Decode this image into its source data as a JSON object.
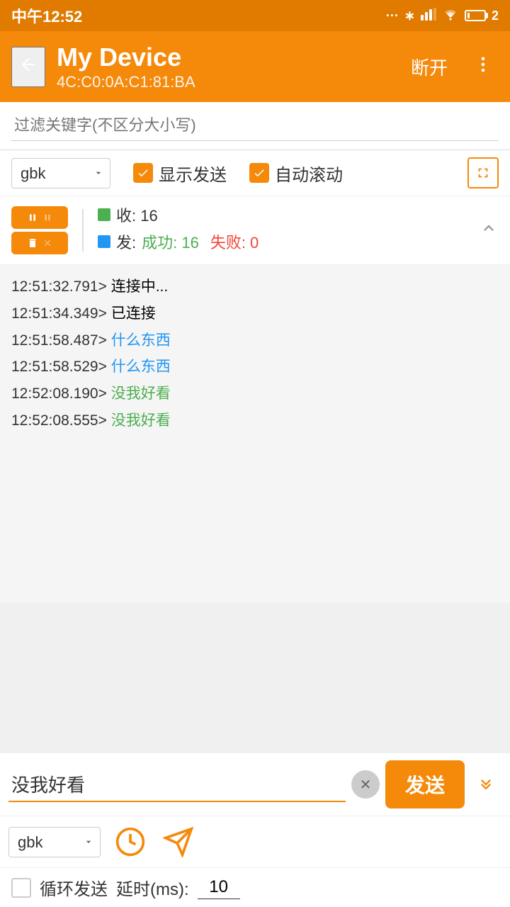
{
  "statusBar": {
    "time": "中午12:52",
    "batteryLevel": 2
  },
  "toolbar": {
    "back_label": "←",
    "title": "My Device",
    "subtitle": "4C:C0:0A:C1:81:BA",
    "disconnect_label": "断开",
    "more_label": "⋮"
  },
  "filter": {
    "placeholder": "过滤关键字(不区分大小写)"
  },
  "controls": {
    "encoding": "gbk",
    "show_send_label": "显示发送",
    "auto_scroll_label": "自动滚动",
    "fullscreen_label": "⤢"
  },
  "stats": {
    "recv_label": "收: 16",
    "send_label": "发: 成功: 16 失败: 0",
    "success_count": 16,
    "fail_count": 0
  },
  "log": {
    "entries": [
      {
        "timestamp": "12:51:32.791>",
        "message": "连接中...",
        "color": "default"
      },
      {
        "timestamp": "12:51:34.349>",
        "message": "已连接",
        "color": "default"
      },
      {
        "timestamp": "12:51:58.487>",
        "message": "什么东西",
        "color": "blue"
      },
      {
        "timestamp": "12:51:58.529>",
        "message": "什么东西",
        "color": "blue"
      },
      {
        "timestamp": "12:52:08.190>",
        "message": "没我好看",
        "color": "green"
      },
      {
        "timestamp": "12:52:08.555>",
        "message": "没我好看",
        "color": "green"
      }
    ]
  },
  "input": {
    "value": "没我好看",
    "send_label": "发送"
  },
  "bottomControls": {
    "encoding": "gbk"
  },
  "loop": {
    "label": "循环发送",
    "delay_label": "延时(ms):",
    "delay_value": "10"
  }
}
